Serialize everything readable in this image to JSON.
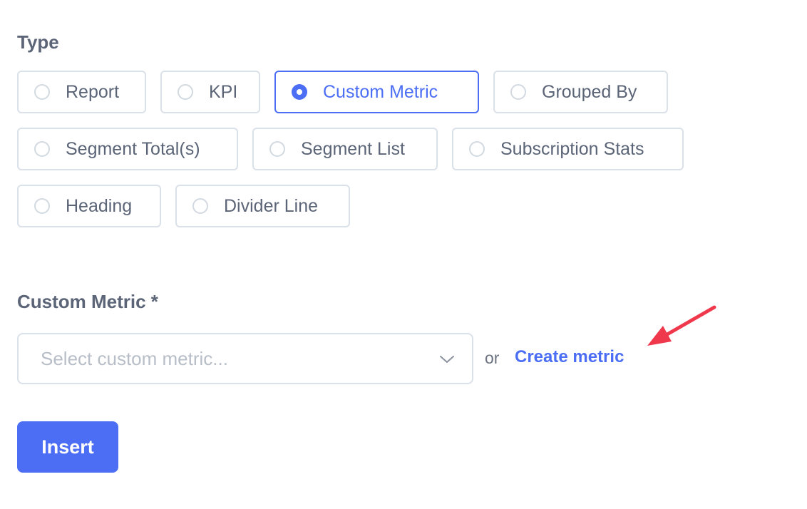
{
  "type_section": {
    "label": "Type",
    "options": [
      {
        "label": "Report",
        "selected": false
      },
      {
        "label": "KPI",
        "selected": false
      },
      {
        "label": "Custom Metric",
        "selected": true
      },
      {
        "label": "Grouped By",
        "selected": false
      },
      {
        "label": "Segment Total(s)",
        "selected": false
      },
      {
        "label": "Segment List",
        "selected": false
      },
      {
        "label": "Subscription Stats",
        "selected": false
      },
      {
        "label": "Heading",
        "selected": false
      },
      {
        "label": "Divider Line",
        "selected": false
      }
    ]
  },
  "custom_metric": {
    "label": "Custom Metric *",
    "select_placeholder": "Select custom metric...",
    "or_text": "or",
    "create_link": "Create metric"
  },
  "actions": {
    "insert_label": "Insert"
  },
  "colors": {
    "accent": "#4c6ef5",
    "label_text": "#5b6577",
    "border": "#dbe1e9",
    "placeholder": "#b8bec7",
    "annotation_arrow": "#f0384c"
  },
  "icons": {
    "select_chevron": "chevron-down-icon",
    "annotation": "red-arrow-annotation"
  }
}
